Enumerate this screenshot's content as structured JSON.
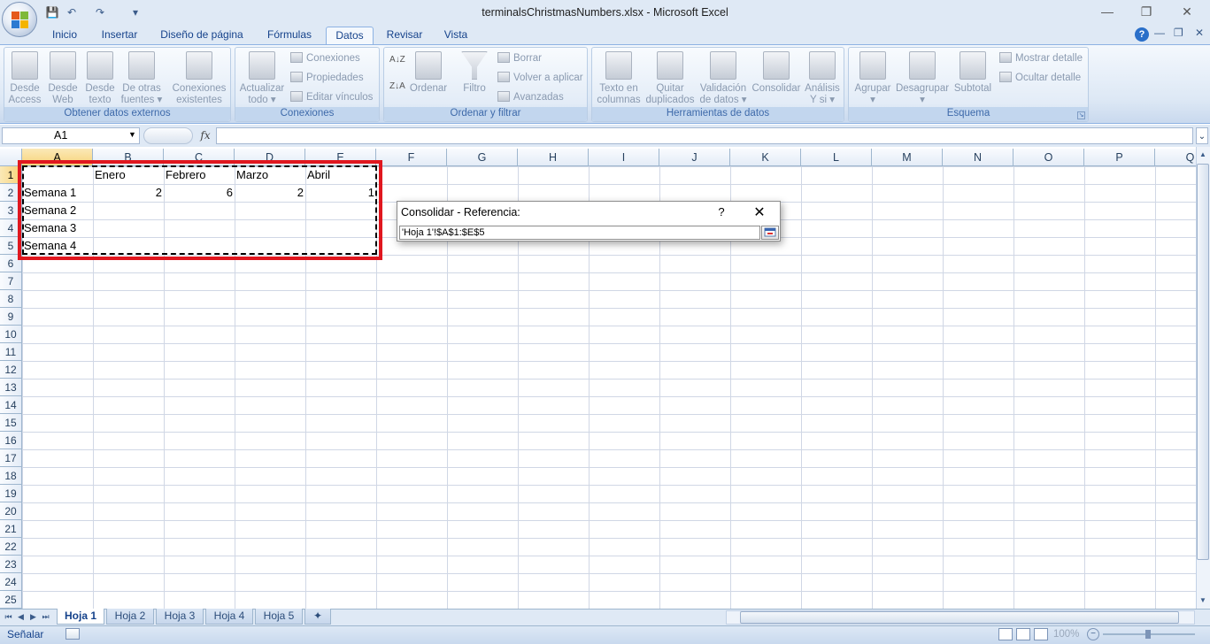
{
  "window": {
    "title": "terminalsChristmasNumbers.xlsx - Microsoft Excel",
    "minimize": "—",
    "restore": "❐",
    "close": "✕"
  },
  "qat": {
    "save": "💾",
    "undo": "↶",
    "redo": "↷",
    "more": "▾"
  },
  "tabs": [
    "Inicio",
    "Insertar",
    "Diseño de página",
    "Fórmulas",
    "Datos",
    "Revisar",
    "Vista"
  ],
  "active_tab": "Datos",
  "ribbon": {
    "groups": [
      {
        "label": "Obtener datos externos",
        "buttons": [
          "Desde\nAccess",
          "Desde\nWeb",
          "Desde\ntexto",
          "De otras\nfuentes ▾",
          "Conexiones\nexistentes"
        ]
      },
      {
        "label": "Conexiones",
        "big": "Actualizar\ntodo ▾",
        "small": [
          "Conexiones",
          "Propiedades",
          "Editar vínculos"
        ]
      },
      {
        "label": "Ordenar y filtrar",
        "buttons": [
          "Ordenar",
          "Filtro"
        ],
        "small": [
          "Borrar",
          "Volver a aplicar",
          "Avanzadas"
        ]
      },
      {
        "label": "Herramientas de datos",
        "buttons": [
          "Texto en\ncolumnas",
          "Quitar\nduplicados",
          "Validación\nde datos ▾",
          "Consolidar",
          "Análisis\nY si ▾"
        ]
      },
      {
        "label": "Esquema",
        "buttons": [
          "Agrupar\n▾",
          "Desagrupar\n▾",
          "Subtotal"
        ],
        "small": [
          "Mostrar detalle",
          "Ocultar detalle"
        ]
      }
    ]
  },
  "formula_bar": {
    "name_box": "A1",
    "fx": "fx",
    "value": ""
  },
  "columns": [
    "A",
    "B",
    "C",
    "D",
    "E",
    "F",
    "G",
    "H",
    "I",
    "J",
    "K",
    "L",
    "M",
    "N",
    "O",
    "P",
    "Q"
  ],
  "rows": [
    "1",
    "2",
    "3",
    "4",
    "5",
    "6",
    "7",
    "8",
    "9",
    "10",
    "11",
    "12",
    "13",
    "14",
    "15",
    "16",
    "17",
    "18",
    "19",
    "20",
    "21",
    "22",
    "23",
    "24",
    "25"
  ],
  "cells": {
    "B1": "Enero",
    "C1": "Febrero",
    "D1": "Marzo",
    "E1": "Abril",
    "A2": "Semana 1",
    "B2": "2",
    "C2": "6",
    "D2": "2",
    "E2": "1",
    "A3": "Semana 2",
    "A4": "Semana 3",
    "A5": "Semana 4"
  },
  "dialog": {
    "title": "Consolidar - Referencia:",
    "help": "?",
    "close": "✕",
    "reference": "'Hoja 1'!$A$1:$E$5"
  },
  "sheets": [
    "Hoja 1",
    "Hoja 2",
    "Hoja 3",
    "Hoja 4",
    "Hoja 5"
  ],
  "active_sheet": "Hoja 1",
  "status": {
    "text": "Señalar",
    "zoom": "100%"
  },
  "colors": {
    "accent": "#15428b",
    "highlight": "#e0171f",
    "selected_header": "#f7d37a"
  }
}
